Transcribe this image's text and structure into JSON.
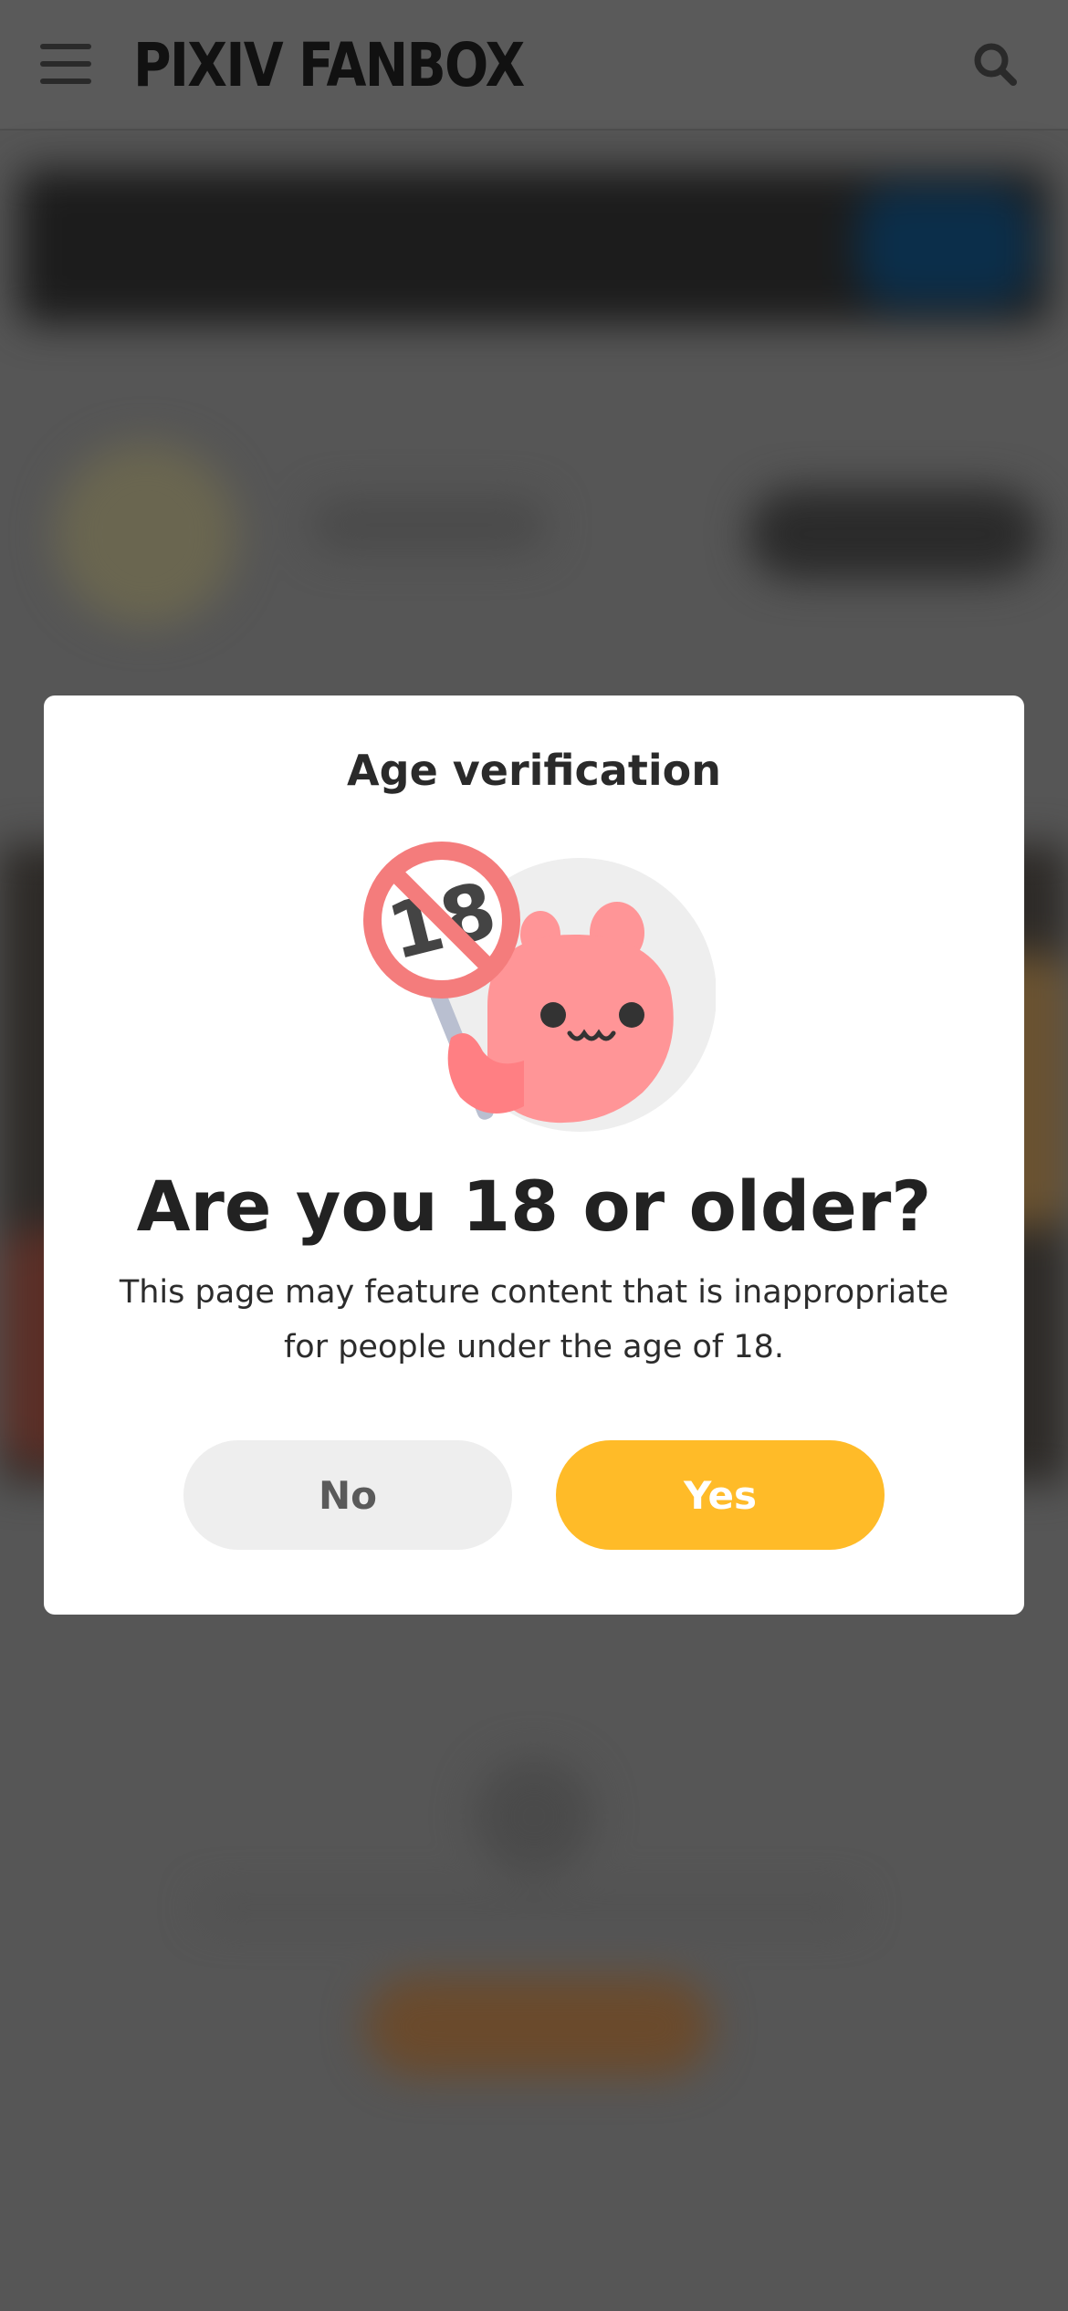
{
  "header": {
    "logo": "PIXIV FANBOX",
    "menu_icon": "hamburger-menu-icon",
    "search_icon": "search-icon"
  },
  "modal": {
    "title": "Age verification",
    "illustration_icon": "age-18-restriction-mascot",
    "headline": "Are you 18 or older?",
    "description": "This page may feature content that is inappropriate for people under the age of 18.",
    "no_label": "No",
    "yes_label": "Yes"
  },
  "colors": {
    "overlay": "#565656",
    "modal_bg": "#ffffff",
    "yes_button": "#ffbb28",
    "no_button": "#eeeeee",
    "mascot_pink": "#ff9597",
    "restriction_red": "#f47c7c"
  }
}
